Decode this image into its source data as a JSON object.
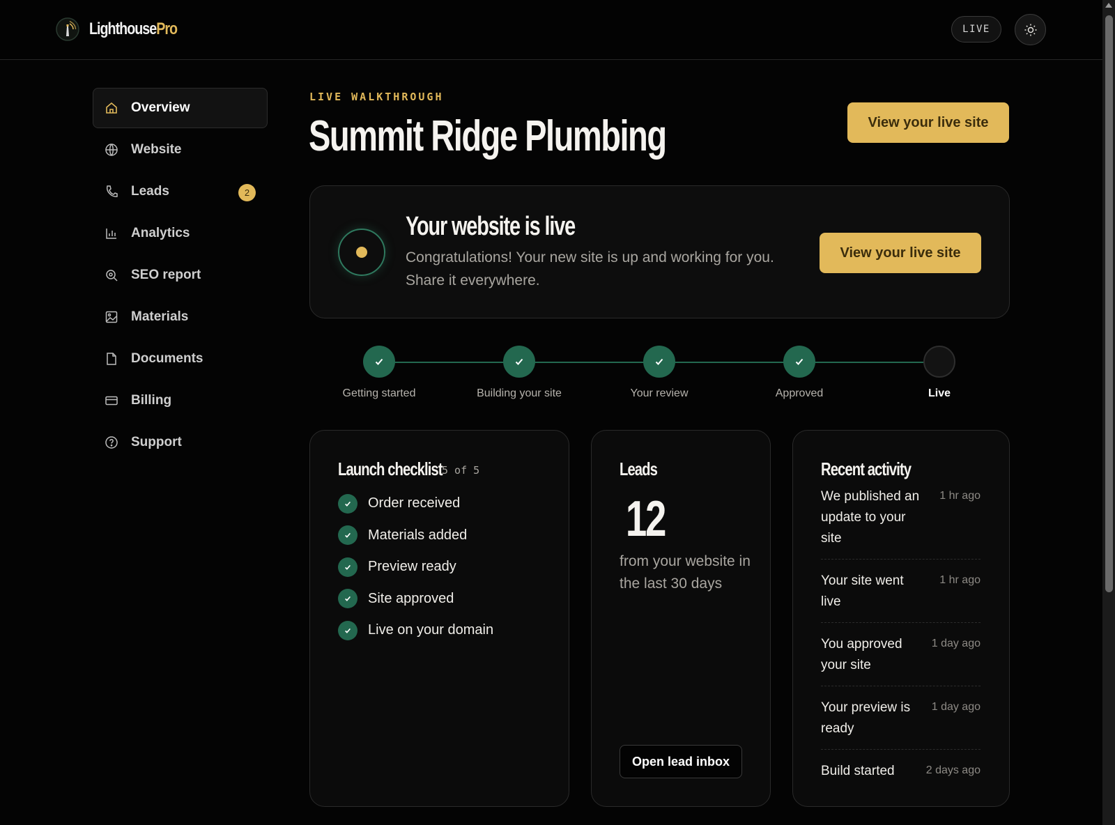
{
  "brand": {
    "name_main": "Lighthouse",
    "name_accent": "Pro"
  },
  "header": {
    "status_pill": "LIVE",
    "theme_toggle_icon": "sun-icon"
  },
  "sidebar": {
    "items": [
      {
        "label": "Overview",
        "icon": "home-icon",
        "active": true
      },
      {
        "label": "Website",
        "icon": "globe-icon"
      },
      {
        "label": "Leads",
        "icon": "phone-icon",
        "badge": "2"
      },
      {
        "label": "Analytics",
        "icon": "bar-chart-icon"
      },
      {
        "label": "SEO report",
        "icon": "search-icon"
      },
      {
        "label": "Materials",
        "icon": "image-icon"
      },
      {
        "label": "Documents",
        "icon": "document-icon"
      },
      {
        "label": "Billing",
        "icon": "credit-card-icon"
      },
      {
        "label": "Support",
        "icon": "help-circle-icon"
      }
    ]
  },
  "main": {
    "eyebrow": "LIVE WALKTHROUGH",
    "title": "Summit Ridge Plumbing",
    "header_button": "View your live site"
  },
  "live_card": {
    "title": "Your website is live",
    "subtitle": "Congratulations! Your new site is up and working for you. Share it everywhere.",
    "button": "View your live site"
  },
  "stepper": {
    "steps": [
      {
        "label": "Getting started",
        "done": true
      },
      {
        "label": "Building your site",
        "done": true
      },
      {
        "label": "Your review",
        "done": true
      },
      {
        "label": "Approved",
        "done": true
      },
      {
        "label": "Live",
        "done": false,
        "current": true
      }
    ]
  },
  "checklist": {
    "title": "Launch checklist",
    "count": "5 of 5",
    "items": [
      "Order received",
      "Materials added",
      "Preview ready",
      "Site approved",
      "Live on your domain"
    ]
  },
  "leads": {
    "title": "Leads",
    "count": "12",
    "subtitle": "from your website in the last 30 days",
    "button": "Open lead inbox"
  },
  "activity": {
    "title": "Recent activity",
    "items": [
      {
        "text": "We published an update to your site",
        "time": "1 hr ago"
      },
      {
        "text": "Your site went live",
        "time": "1 hr ago"
      },
      {
        "text": "You approved your site",
        "time": "1 day ago"
      },
      {
        "text": "Your preview is ready",
        "time": "1 day ago"
      },
      {
        "text": "Build started",
        "time": "2 days ago"
      }
    ]
  },
  "colors": {
    "accent_gold": "#e2b95a",
    "success_green": "#23684f",
    "background": "#040404",
    "card": "#0d0d0d"
  }
}
